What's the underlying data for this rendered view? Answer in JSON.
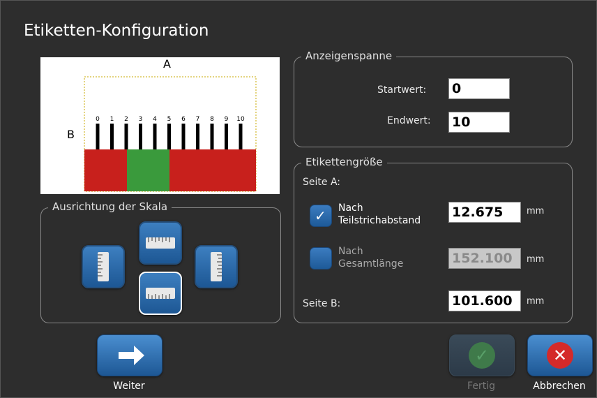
{
  "dialog": {
    "title": "Etiketten-Konfiguration"
  },
  "preview": {
    "label_a": "A",
    "label_b": "B",
    "ticks": [
      "0",
      "1",
      "2",
      "3",
      "4",
      "5",
      "6",
      "7",
      "8",
      "9",
      "10"
    ],
    "colors": {
      "red": "#c8201c",
      "green": "#3a9a3c"
    }
  },
  "alignment": {
    "legend": "Ausrichtung der Skala",
    "options": [
      {
        "name": "ruler-left-icon"
      },
      {
        "name": "ruler-top-icon"
      },
      {
        "name": "ruler-right-icon"
      },
      {
        "name": "ruler-bottom-icon",
        "selected": true
      }
    ]
  },
  "span": {
    "legend": "Anzeigenspanne",
    "start_label": "Startwert:",
    "start_value": "0",
    "end_label": "Endwert:",
    "end_value": "10"
  },
  "size": {
    "legend": "Etikettengröße",
    "side_a_label": "Seite A:",
    "by_tick_label_1": "Nach",
    "by_tick_label_2": "Teilstrichabstand",
    "by_tick_checked": true,
    "by_tick_value": "12.675",
    "by_total_label_1": "Nach",
    "by_total_label_2": "Gesamtlänge",
    "by_total_checked": false,
    "by_total_value": "152.100",
    "side_b_label": "Seite B:",
    "side_b_value": "101.600",
    "unit": "mm"
  },
  "footer": {
    "next_label": "Weiter",
    "done_label": "Fertig",
    "cancel_label": "Abbrechen"
  }
}
